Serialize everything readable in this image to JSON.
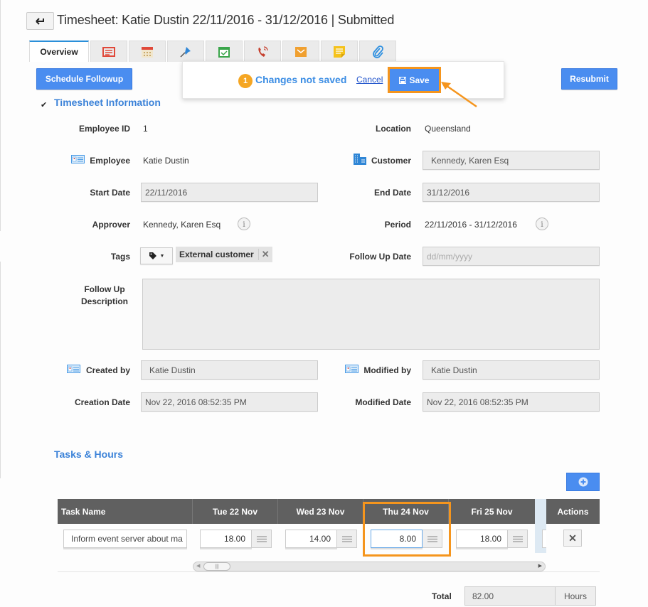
{
  "header": {
    "back_icon": "back-arrow-icon",
    "title": "Timesheet: Katie Dustin 22/11/2016 - 31/12/2016 | Submitted"
  },
  "tabs": [
    {
      "label": "Overview",
      "active": true
    },
    {
      "icon": "details-list-icon",
      "color": "#e0493a"
    },
    {
      "icon": "calendar-icon",
      "color": "#e0493a"
    },
    {
      "icon": "pushpin-icon",
      "color": "#2f86d6"
    },
    {
      "icon": "calendar-check-icon",
      "color": "#3aa54a"
    },
    {
      "icon": "phone-call-icon",
      "color": "#c6402e"
    },
    {
      "icon": "email-icon",
      "color": "#f0a030"
    },
    {
      "icon": "sticky-note-icon",
      "color": "#f5c21a"
    },
    {
      "icon": "paperclip-icon",
      "color": "#2f90e0"
    }
  ],
  "actions": {
    "schedule_followup": "Schedule Followup",
    "resubmit": "Resubmit"
  },
  "unsaved": {
    "count": "1",
    "message": "Changes not saved",
    "cancel": "Cancel",
    "save": "Save"
  },
  "sections": {
    "info_title": "Timesheet Information",
    "tasks_title": "Tasks & Hours"
  },
  "form": {
    "employee_id_label": "Employee ID",
    "employee_id": "1",
    "location_label": "Location",
    "location": "Queensland",
    "employee_label": "Employee",
    "employee": "Katie Dustin",
    "customer_label": "Customer",
    "customer": "Kennedy, Karen Esq",
    "start_date_label": "Start Date",
    "start_date": "22/11/2016",
    "end_date_label": "End Date",
    "end_date": "31/12/2016",
    "approver_label": "Approver",
    "approver": "Kennedy, Karen Esq",
    "period_label": "Period",
    "period": "22/11/2016 - 31/12/2016",
    "tags_label": "Tags",
    "tag": "External customer",
    "followup_date_label": "Follow Up Date",
    "followup_date_placeholder": "dd/mm/yyyy",
    "followup_desc_label_1": "Follow Up",
    "followup_desc_label_2": "Description",
    "followup_desc": "",
    "created_by_label": "Created by",
    "created_by": "Katie Dustin",
    "modified_by_label": "Modified by",
    "modified_by": "Katie Dustin",
    "creation_date_label": "Creation Date",
    "creation_date": "Nov 22, 2016 08:52:35 PM",
    "modified_date_label": "Modified Date",
    "modified_date": "Nov 22, 2016 08:52:35 PM"
  },
  "table": {
    "columns": [
      "Task Name",
      "Tue 22 Nov",
      "Wed 23 Nov",
      "Thu 24 Nov",
      "Fri 25 Nov",
      "Actions"
    ],
    "rows": [
      {
        "task": "Inform event server about ma",
        "hours": [
          "18.00",
          "14.00",
          "8.00",
          "18.00"
        ]
      }
    ]
  },
  "total": {
    "label": "Total",
    "value": "82.00",
    "unit": "Hours"
  },
  "colors": {
    "accent": "#4a8df0",
    "highlight": "#f5951d",
    "section_title": "#3b82d8",
    "header_bg": "#606060"
  }
}
